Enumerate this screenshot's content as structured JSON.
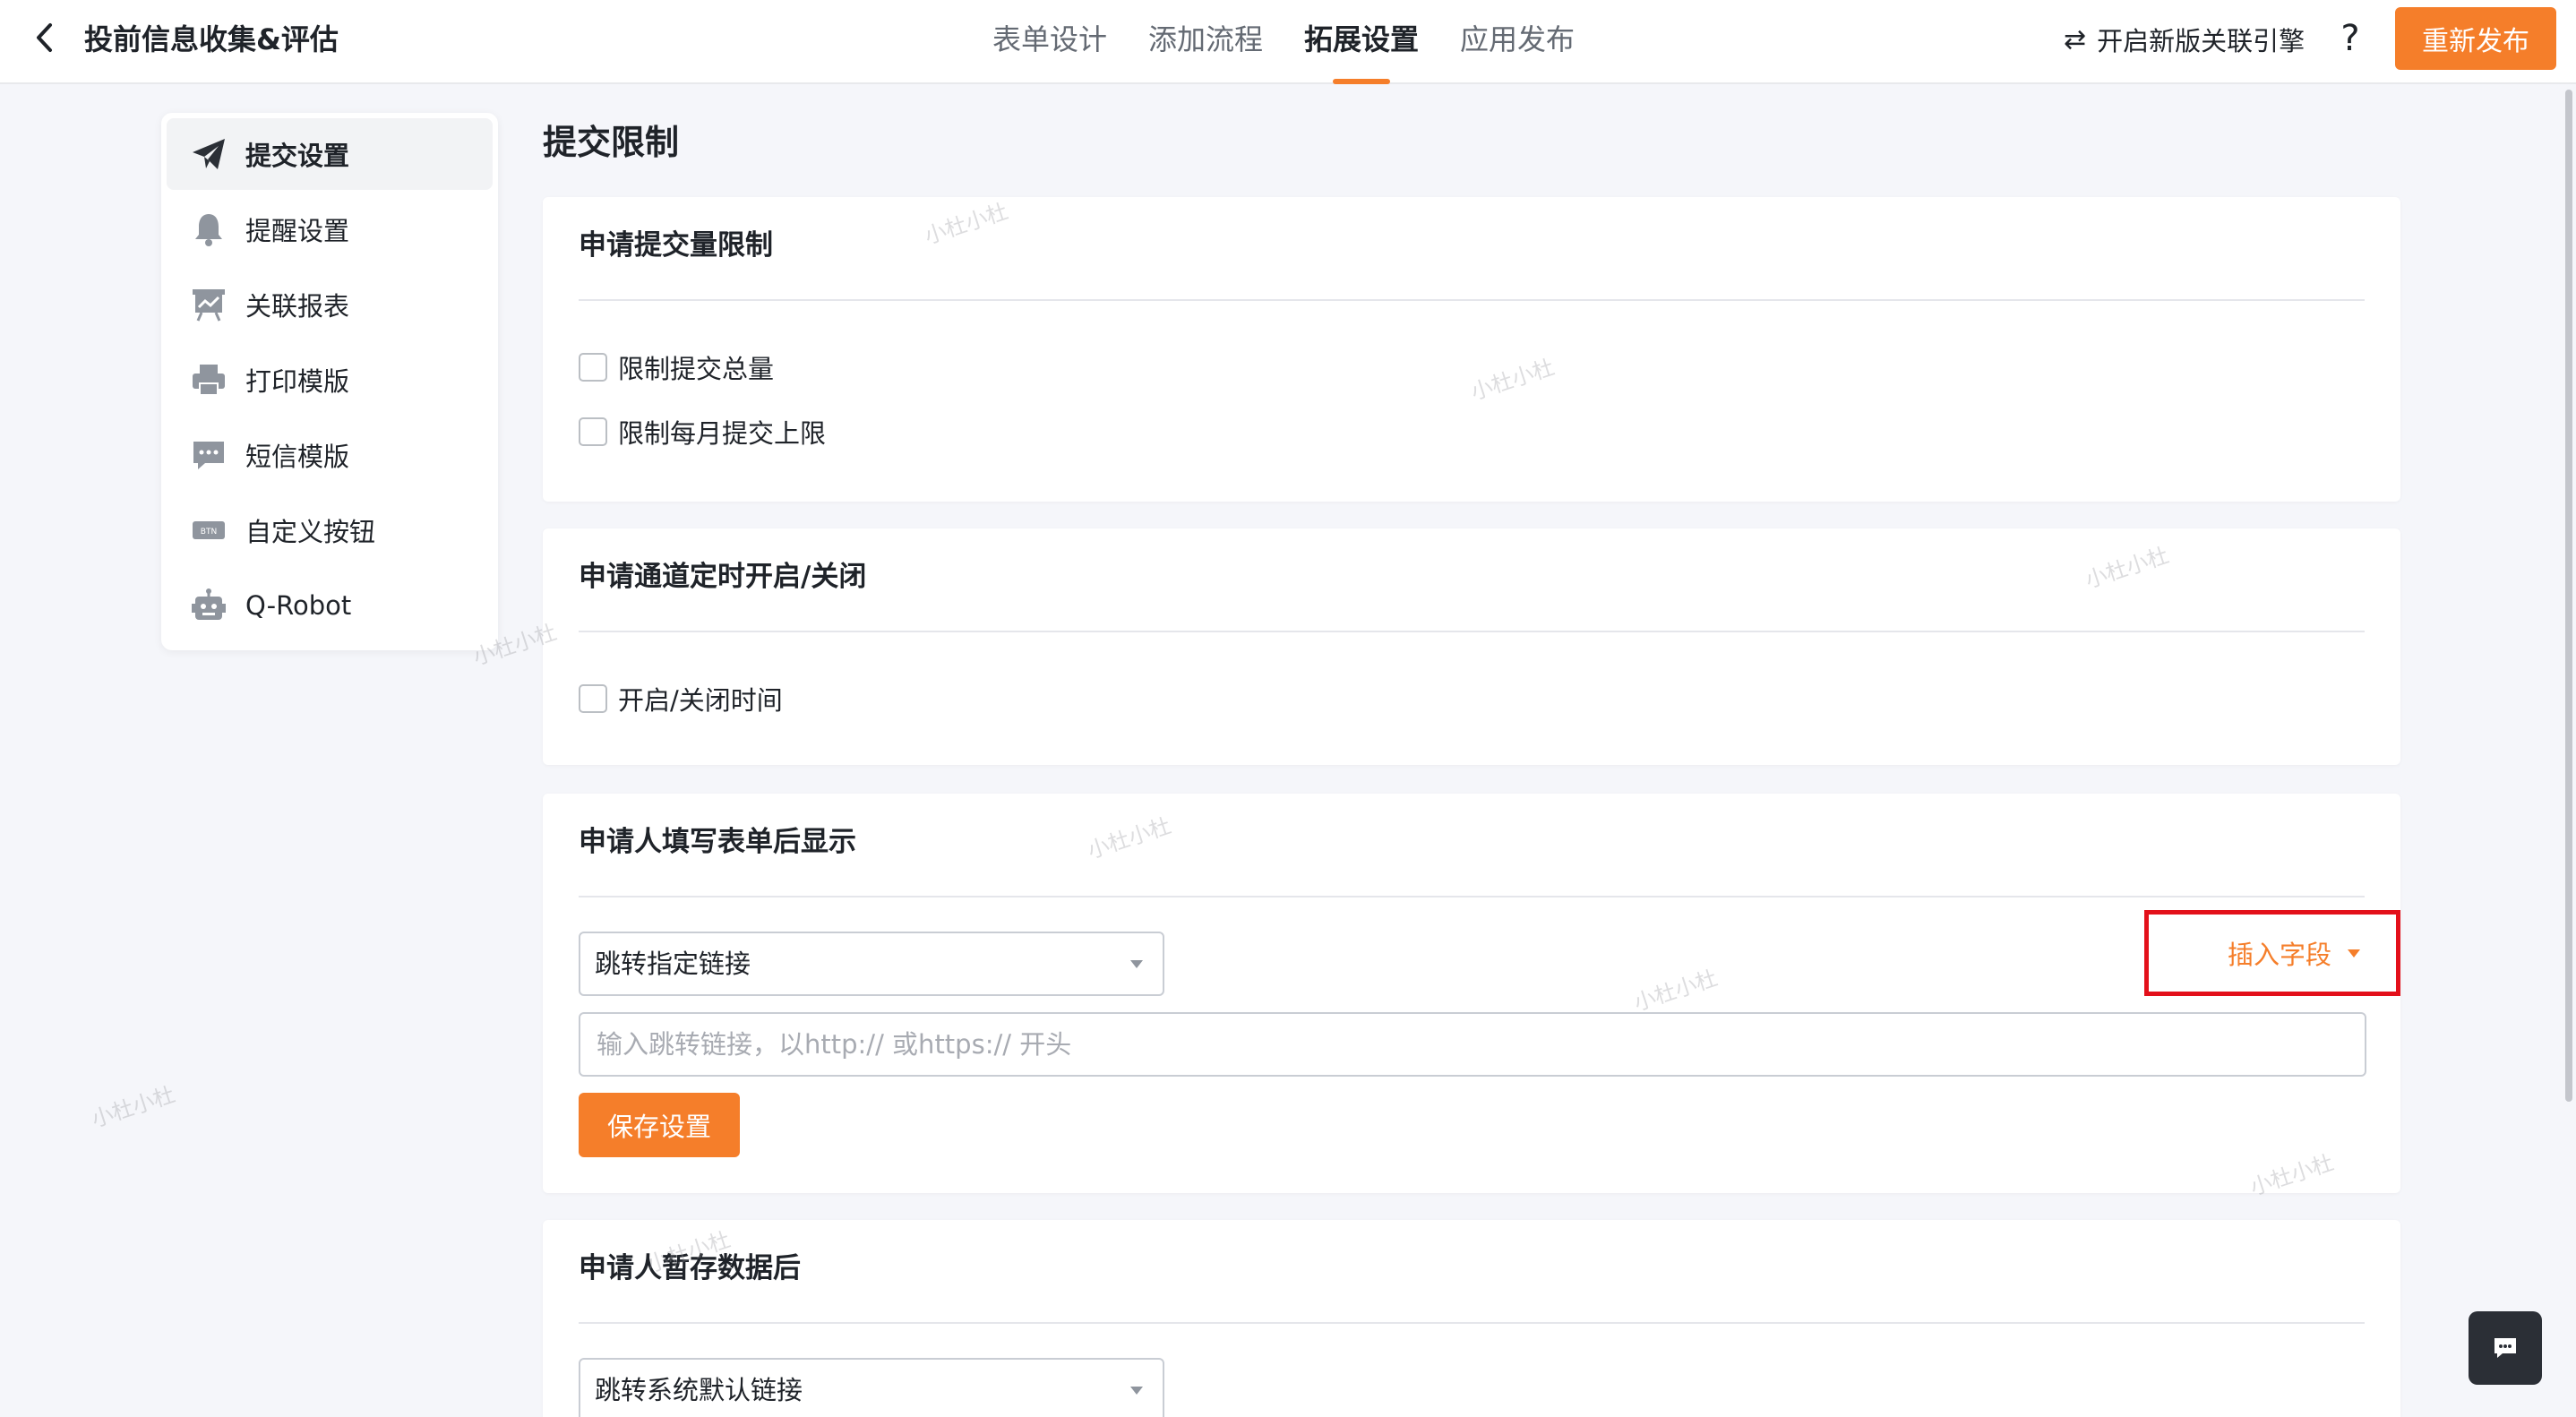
{
  "header": {
    "title": "投前信息收集&评估",
    "tabs": [
      {
        "label": "表单设计",
        "active": false
      },
      {
        "label": "添加流程",
        "active": false
      },
      {
        "label": "拓展设置",
        "active": true
      },
      {
        "label": "应用发布",
        "active": false
      }
    ],
    "new_engine_label": "开启新版关联引擎",
    "help_label": "?",
    "republish_label": "重新发布"
  },
  "sidebar": {
    "items": [
      {
        "label": "提交设置",
        "icon": "paper-plane-icon",
        "active": true
      },
      {
        "label": "提醒设置",
        "icon": "bell-icon",
        "active": false
      },
      {
        "label": "关联报表",
        "icon": "report-board-icon",
        "active": false
      },
      {
        "label": "打印模版",
        "icon": "printer-icon",
        "active": false
      },
      {
        "label": "短信模版",
        "icon": "message-bubble-icon",
        "active": false
      },
      {
        "label": "自定义按钮",
        "icon": "btn-badge-icon",
        "active": false
      },
      {
        "label": "Q-Robot",
        "icon": "robot-icon",
        "active": false
      }
    ],
    "btn_badge_text": "BTN"
  },
  "main": {
    "section_title": "提交限制",
    "submit_limit": {
      "title": "申请提交量限制",
      "options": [
        {
          "label": "限制提交总量",
          "checked": false
        },
        {
          "label": "限制每月提交上限",
          "checked": false
        }
      ]
    },
    "schedule": {
      "title": "申请通道定时开启/关闭",
      "option": {
        "label": "开启/关闭时间",
        "checked": false
      }
    },
    "after_submit": {
      "title": "申请人填写表单后显示",
      "select_value": "跳转指定链接",
      "insert_field_label": "插入字段",
      "url_placeholder": "输入跳转链接，以http:// 或https:// 开头",
      "url_value": "",
      "save_label": "保存设置"
    },
    "after_draft": {
      "title": "申请人暂存数据后",
      "select_value": "跳转系统默认链接"
    }
  },
  "watermark_text": "小杜小杜",
  "colors": {
    "accent": "#f57e2a",
    "highlight_box": "#e3101a",
    "background": "#f5f6fa"
  }
}
